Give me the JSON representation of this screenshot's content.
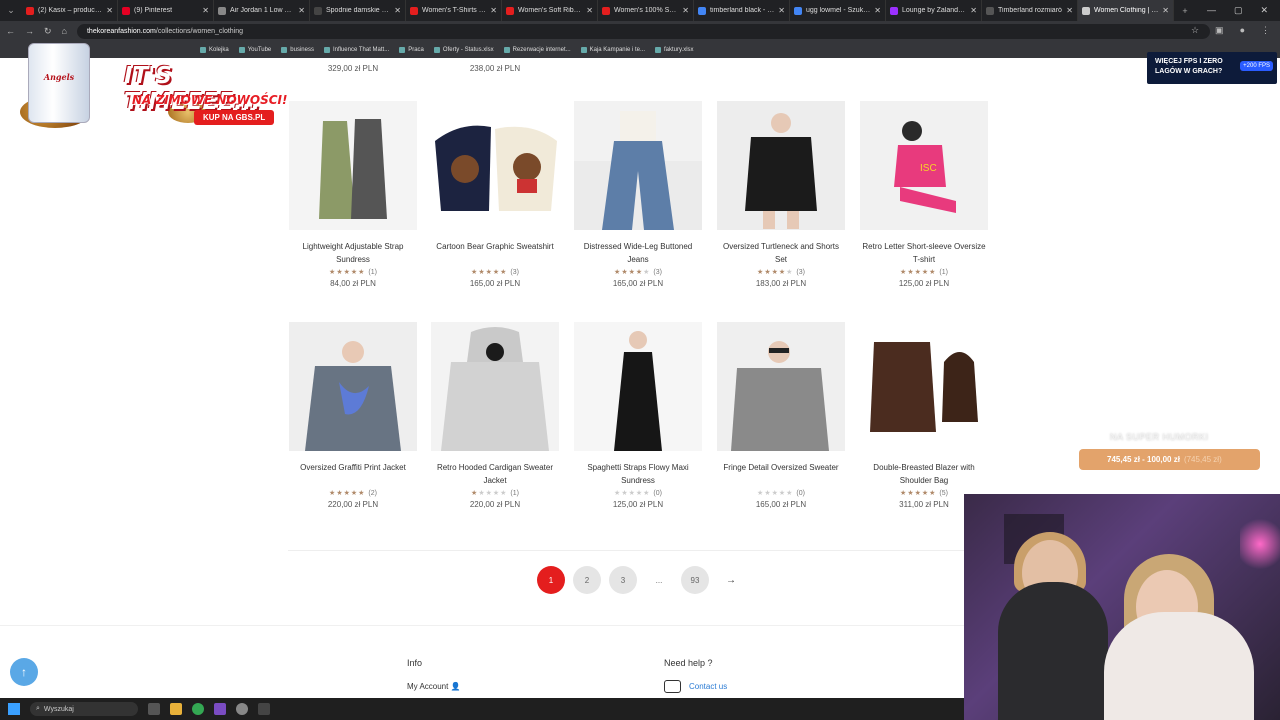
{
  "browser": {
    "tabs": [
      {
        "label": "(2) Kasix – producent",
        "color": "#e41e1e"
      },
      {
        "label": "(9) Pinterest",
        "color": "#e60023"
      },
      {
        "label": "Air Jordan 1 Low Trabis",
        "color": "#888888"
      },
      {
        "label": "Spodnie damskie spod",
        "color": "#444444"
      },
      {
        "label": "Women's T-Shirts | Ur",
        "color": "#e41e1e"
      },
      {
        "label": "Women's Soft Ribbed",
        "color": "#e41e1e"
      },
      {
        "label": "Women's 100% Supim",
        "color": "#e41e1e"
      },
      {
        "label": "timberland black - Szu",
        "color": "#4285f4"
      },
      {
        "label": "ugg lowmel - Szukaj w",
        "color": "#4285f4"
      },
      {
        "label": "Lounge by Zalando –",
        "color": "#9b30ff"
      },
      {
        "label": "Timberland rozmiaró",
        "color": "#555555"
      },
      {
        "label": "Women Clothing | Ko",
        "color": "#cccccc",
        "active": true
      }
    ],
    "url_host": "thekoreanfashion.com",
    "url_path": "/collections/women_clothing",
    "bookmarks": [
      "Kolejka",
      "YouTube",
      "business",
      "Influence That Matt...",
      "Praca",
      "Oferty - Status.xlsx",
      "Rezerwacje internet...",
      "Kaja Kampanie i te...",
      "faktury.xlsx"
    ]
  },
  "top_prices": [
    "329,00 zł PLN",
    "238,00 zł PLN"
  ],
  "products_row1": [
    {
      "name": "Lightweight Adjustable Strap Sundress",
      "stars": 5,
      "count": "(1)",
      "price": "84,00 zł PLN",
      "img": "sundress"
    },
    {
      "name": "Cartoon Bear Graphic Sweatshirt",
      "stars": 5,
      "count": "(3)",
      "price": "165,00 zł PLN",
      "img": "bear"
    },
    {
      "name": "Distressed Wide-Leg Buttoned Jeans",
      "stars": 3.5,
      "count": "(3)",
      "price": "165,00 zł PLN",
      "img": "jeans"
    },
    {
      "name": "Oversized Turtleneck and Shorts Set",
      "stars": 3.5,
      "count": "(3)",
      "price": "183,00 zł PLN",
      "img": "turtleneck"
    },
    {
      "name": "Retro Letter Short-sleeve Oversize T-shirt",
      "stars": 5,
      "count": "(1)",
      "price": "125,00 zł PLN",
      "img": "tshirt"
    }
  ],
  "products_row2": [
    {
      "name": "Oversized Graffiti Print Jacket",
      "stars": 5,
      "count": "(2)",
      "price": "220,00 zł PLN",
      "img": "graffiti"
    },
    {
      "name": "Retro Hooded Cardigan Sweater Jacket",
      "stars": 1,
      "count": "(1)",
      "price": "220,00 zł PLN",
      "img": "hooded"
    },
    {
      "name": "Spaghetti Straps Flowy Maxi Sundress",
      "stars": 0,
      "count": "(0)",
      "price": "125,00 zł PLN",
      "img": "maxi"
    },
    {
      "name": "Fringe Detail Oversized Sweater",
      "stars": 0,
      "count": "(0)",
      "price": "165,00 zł PLN",
      "img": "fringe"
    },
    {
      "name": "Double-Breasted Blazer with Shoulder Bag",
      "stars": 5,
      "count": "(5)",
      "price": "311,00 zł PLN",
      "img": "blazer"
    }
  ],
  "pagination": {
    "pages": [
      "1",
      "2",
      "3",
      "...",
      "93"
    ],
    "current": "1",
    "next": "→"
  },
  "footer": {
    "info_title": "Info",
    "my_account": "My Account",
    "help_title": "Need help ?",
    "contact": "Contact us"
  },
  "ad_left": {
    "can_text": "Angels",
    "headline": "IT'S TIMEEEE...",
    "sub": "NA ZIMOWE NOWOŚCI!",
    "cta": "KUP NA GBS.PL"
  },
  "ad_right": {
    "line1": "WIĘCEJ FPS I ZERO",
    "line2": "LAGÓW W GRACH?",
    "chip": "+200 FPS"
  },
  "stream_alert": {
    "title": "NA SUPER HUMORKI",
    "amount": "745,45 zł - 100,00 zł",
    "faint": "(745,45 zł)"
  },
  "taskbar": {
    "search": "Wyszukaj"
  },
  "accent": "#e41e1e"
}
